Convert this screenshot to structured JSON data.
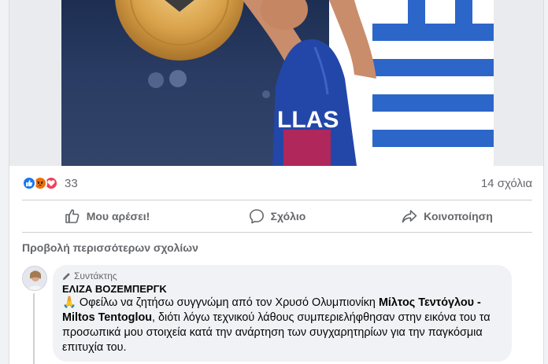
{
  "post": {
    "stats": {
      "reaction_count": "33",
      "comments_label": "14 σχόλια"
    },
    "actions": {
      "like_label": "Μου αρέσει!",
      "comment_label": "Σχόλιο",
      "share_label": "Κοινοποίηση"
    },
    "photo_text": "LLAS"
  },
  "comments": {
    "view_more_label": "Προβολή περισσότερων σχολίων",
    "item": {
      "badge": "Συντάκτης",
      "author": "ΕΛΙΖΑ ΒΟΖΕΜΠΕΡΓΚ",
      "emoji": "🙏",
      "text_part1": "Οφείλω να ζητήσω συγγνώμη από τον Χρυσό Ολυμπιονίκη",
      "text_bold": "Μίλτος Τεντόγλου - Miltos Tentoglou",
      "text_part2": ", διότι λόγω τεχνικού λάθους συμπεριελήφθησαν στην εικόνα του τα προσωπικά μου στοιχεία κατά την ανάρτηση των συγχαρητηρίων για την παγκόσμια επιτυχία του."
    }
  },
  "icons": [
    "like-reaction-icon",
    "angry-reaction-icon",
    "love-reaction-icon",
    "thumbs-up-icon",
    "comment-bubble-icon",
    "share-arrow-icon",
    "pencil-icon"
  ],
  "colors": {
    "facebook_blue": "#1877f2",
    "muted_text": "#65676b",
    "bubble_bg": "#f0f2f5"
  }
}
